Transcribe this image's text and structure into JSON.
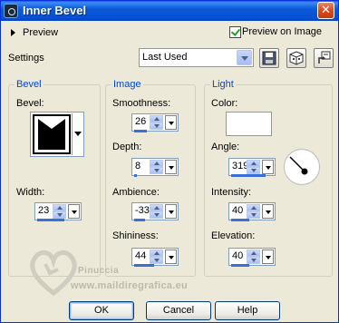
{
  "window": {
    "title": "Inner Bevel",
    "close_glyph": "✕"
  },
  "preview": {
    "label": "Preview",
    "preview_on_image_label": "Preview on Image",
    "preview_on_image_checked": true
  },
  "settings": {
    "label": "Settings",
    "selected": "Last Used"
  },
  "toolbar_icons": [
    "save-preset-icon",
    "randomize-icon",
    "reset-icon"
  ],
  "bevel": {
    "legend": "Bevel",
    "bevel_label": "Bevel:",
    "width_label": "Width:",
    "width_value": "23"
  },
  "image": {
    "legend": "Image",
    "smoothness_label": "Smoothness:",
    "smoothness_value": "26",
    "depth_label": "Depth:",
    "depth_value": "8",
    "ambience_label": "Ambience:",
    "ambience_value": "-33",
    "shininess_label": "Shininess:",
    "shininess_value": "44"
  },
  "light": {
    "legend": "Light",
    "color_label": "Color:",
    "color_value": "#ffffff",
    "angle_label": "Angle:",
    "angle_value": "319",
    "intensity_label": "Intensity:",
    "intensity_value": "40",
    "elevation_label": "Elevation:",
    "elevation_value": "40"
  },
  "watermark": {
    "name": "Pinuccia",
    "url": "www.maildiregrafica.eu"
  },
  "buttons": {
    "ok": "OK",
    "cancel": "Cancel",
    "help": "Help"
  },
  "colors": {
    "titlebar": "#0550d4",
    "dialog": "#ece9d8",
    "accent": "#0046d5"
  }
}
